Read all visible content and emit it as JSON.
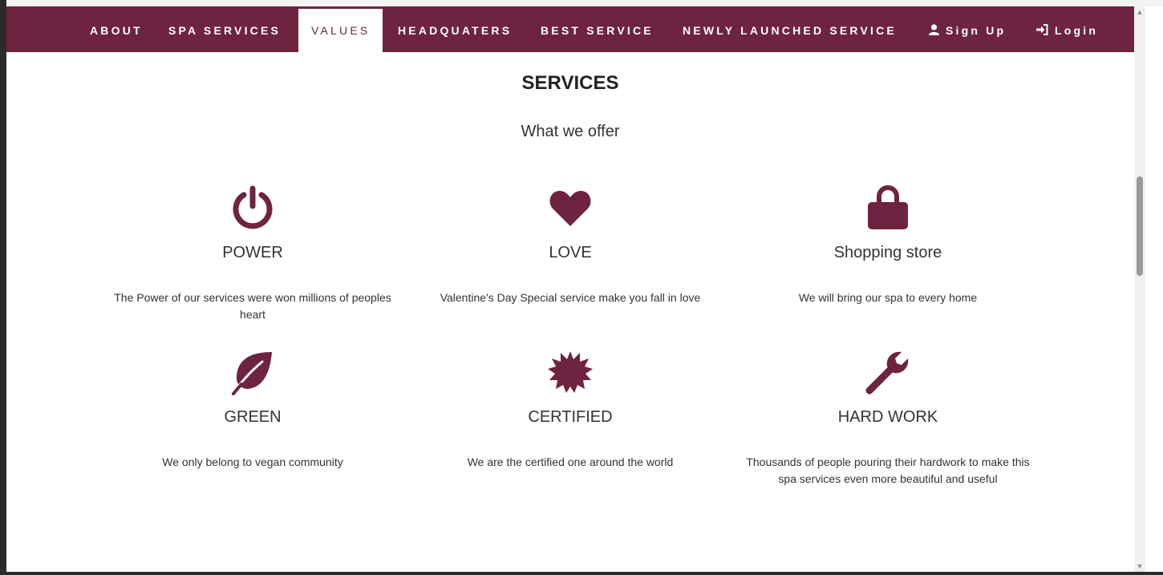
{
  "nav": {
    "items": [
      {
        "label": "ABOUT"
      },
      {
        "label": "SPA SERVICES"
      },
      {
        "label": "VALUES",
        "active": true
      },
      {
        "label": "HEADQUATERS"
      },
      {
        "label": "BEST SERVICE"
      },
      {
        "label": "NEWLY LAUNCHED SERVICE"
      }
    ],
    "signup": "Sign Up",
    "login": "Login"
  },
  "section": {
    "title": "SERVICES",
    "subtitle": "What we offer"
  },
  "services": [
    {
      "icon": "power-icon",
      "title": "POWER",
      "desc": "The Power of our services were won millions of peoples heart"
    },
    {
      "icon": "heart-icon",
      "title": "LOVE",
      "desc": "Valentine's Day Special service make you fall in love"
    },
    {
      "icon": "lock-icon",
      "title": "Shopping store",
      "desc": "We will bring our spa to every home"
    },
    {
      "icon": "leaf-icon",
      "title": "GREEN",
      "desc": "We only belong to vegan community"
    },
    {
      "icon": "certificate-icon",
      "title": "CERTIFIED",
      "desc": "We are the certified one around the world"
    },
    {
      "icon": "wrench-icon",
      "title": "HARD WORK",
      "desc": "Thousands of people pouring their hardwork to make this spa services even more beautiful and useful"
    }
  ],
  "colors": {
    "brand": "#6e2340",
    "text": "#333333"
  }
}
